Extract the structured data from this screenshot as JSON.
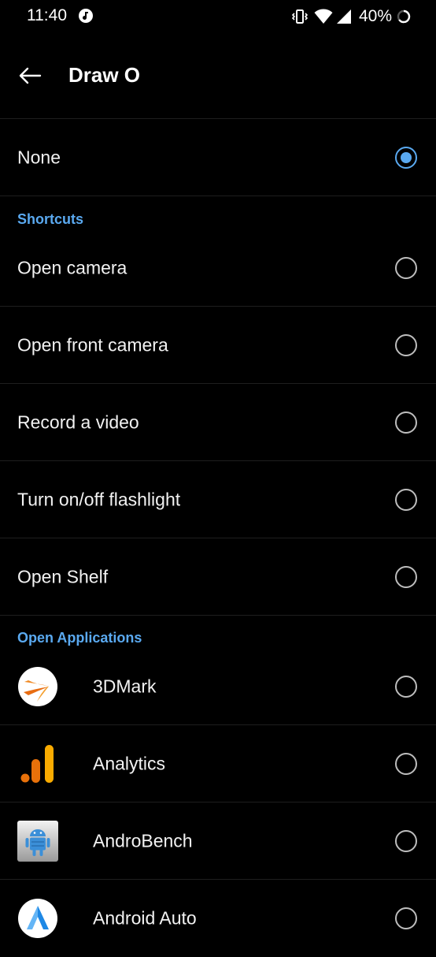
{
  "status_bar": {
    "time": "11:40",
    "battery_percent": "40%",
    "icons": [
      "music-icon",
      "vibrate-icon",
      "wifi-icon",
      "signal-icon",
      "battery-icon"
    ]
  },
  "app_bar": {
    "title": "Draw O",
    "back_icon": "arrow-left-icon"
  },
  "colors": {
    "background": "#000000",
    "accent": "#5aa9f0",
    "text": "#f2f2f2",
    "divider": "#1e1e1e"
  },
  "none_option": {
    "label": "None",
    "selected": true
  },
  "shortcuts": {
    "header": "Shortcuts",
    "items": [
      {
        "label": "Open camera",
        "selected": false
      },
      {
        "label": "Open front camera",
        "selected": false
      },
      {
        "label": "Record a video",
        "selected": false
      },
      {
        "label": "Turn on/off flashlight",
        "selected": false
      },
      {
        "label": "Open Shelf",
        "selected": false
      }
    ]
  },
  "applications": {
    "header": "Open Applications",
    "items": [
      {
        "label": "3DMark",
        "icon": "3dmark-icon",
        "selected": false
      },
      {
        "label": "Analytics",
        "icon": "analytics-icon",
        "selected": false
      },
      {
        "label": "AndroBench",
        "icon": "androbench-icon",
        "selected": false
      },
      {
        "label": "Android Auto",
        "icon": "android-auto-icon",
        "selected": false
      }
    ]
  }
}
